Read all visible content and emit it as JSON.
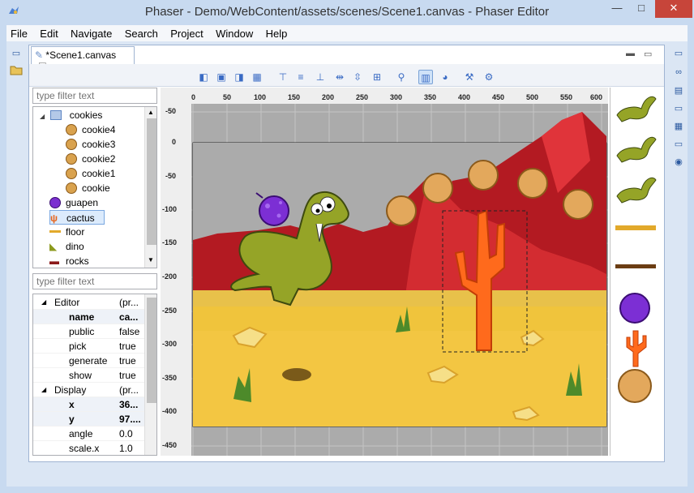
{
  "window": {
    "title": "Phaser - Demo/WebContent/assets/scenes/Scene1.canvas - Phaser Editor",
    "minimize": "—",
    "maximize": "□",
    "close": "✕"
  },
  "menu": [
    {
      "label": "File"
    },
    {
      "label": "Edit"
    },
    {
      "label": "Navigate"
    },
    {
      "label": "Search"
    },
    {
      "label": "Project"
    },
    {
      "label": "Window"
    },
    {
      "label": "Help"
    }
  ],
  "editor_tab": {
    "label": "*Scene1.canvas",
    "close": "☒"
  },
  "outline": {
    "filter_placeholder": "type filter text",
    "items": [
      {
        "label": "cookies",
        "depth": 1,
        "expanded": true,
        "icon": "group-icon"
      },
      {
        "label": "cookie4",
        "depth": 2,
        "icon": "cookie-icon"
      },
      {
        "label": "cookie3",
        "depth": 2,
        "icon": "cookie-icon"
      },
      {
        "label": "cookie2",
        "depth": 2,
        "icon": "cookie-icon"
      },
      {
        "label": "cookie1",
        "depth": 2,
        "icon": "cookie-icon"
      },
      {
        "label": "cookie",
        "depth": 2,
        "icon": "cookie-icon"
      },
      {
        "label": "guapen",
        "depth": 1,
        "icon": "guapen-icon"
      },
      {
        "label": "cactus",
        "depth": 1,
        "icon": "cactus-icon",
        "selected": true
      },
      {
        "label": "floor",
        "depth": 1,
        "icon": "floor-icon"
      },
      {
        "label": "dino",
        "depth": 1,
        "icon": "dino-icon"
      },
      {
        "label": "rocks",
        "depth": 1,
        "icon": "rocks-icon"
      }
    ]
  },
  "properties": {
    "filter_placeholder": "type filter text",
    "rows": [
      {
        "name": "Editor",
        "value": "(pr...",
        "group": true
      },
      {
        "name": "name",
        "value": "ca...",
        "bold": true
      },
      {
        "name": "public",
        "value": "false"
      },
      {
        "name": "pick",
        "value": "true"
      },
      {
        "name": "generate",
        "value": "true"
      },
      {
        "name": "show",
        "value": "true"
      },
      {
        "name": "Display",
        "value": "(pr...",
        "group": true
      },
      {
        "name": "x",
        "value": "36...",
        "bold": true
      },
      {
        "name": "y",
        "value": "97....",
        "bold": true
      },
      {
        "name": "angle",
        "value": "0.0"
      },
      {
        "name": "scale.x",
        "value": "1.0"
      }
    ]
  },
  "ruler": {
    "x_ticks": [
      "0",
      "50",
      "100",
      "150",
      "200",
      "250",
      "300",
      "350",
      "400",
      "450",
      "500",
      "550",
      "600"
    ],
    "y_ticks": [
      "-50",
      "0",
      "-50",
      "-100",
      "-150",
      "-200",
      "-250",
      "-300",
      "-350",
      "-400",
      "-450"
    ]
  },
  "toolbar": {
    "buttons": [
      "align-left-icon",
      "align-center-icon",
      "align-right-icon",
      "align-justify-icon",
      "align-top-icon",
      "align-middle-icon",
      "align-bottom-icon",
      "distribute-h-icon",
      "distribute-v-icon",
      "zoom-icon",
      "layout-icon",
      "palette-icon",
      "wrench-icon",
      "gear-icon"
    ]
  },
  "palette_items": [
    "dino-frame-1",
    "dino-frame-2",
    "dino-frame-3",
    "floor-tile",
    "rocks-tile",
    "guapen",
    "cactus",
    "cookie"
  ],
  "colors": {
    "accent": "#3a6bc4",
    "selection": "#dcebfc",
    "close_button": "#c7453a",
    "canvas_bg": "#ababab"
  }
}
